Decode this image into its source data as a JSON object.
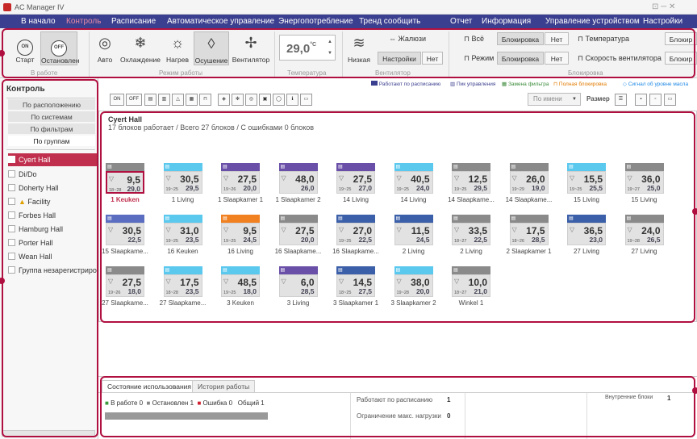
{
  "app": {
    "title": "AC Manager IV",
    "window_controls": "⊡ ─ ✕"
  },
  "menu": [
    {
      "label": "В начало"
    },
    {
      "label": "Контроль",
      "active": true
    },
    {
      "label": "Расписание"
    },
    {
      "label": "Автоматическое управление"
    },
    {
      "label": "Энергопотребление"
    },
    {
      "label": "Тренд сообщить"
    },
    {
      "label": "Отчет"
    },
    {
      "label": "Информация"
    },
    {
      "label": "Управление устройством"
    },
    {
      "label": "Настройки"
    }
  ],
  "ribbon": {
    "power": {
      "start": "Старт",
      "stop": "Остановлен",
      "on_glyph": "ON",
      "off_glyph": "OFF",
      "group": "В работе"
    },
    "modes": {
      "auto": "Авто",
      "cool": "Охлаждение",
      "heat": "Нагрев",
      "dry": "Осушение",
      "fan": "Вентилятор",
      "group": "Режим работы"
    },
    "temperature": {
      "value": "29,0",
      "unit": "°C",
      "group": "Температура"
    },
    "fan": {
      "speed": "Низкая",
      "louver": "Жалюзи",
      "settings": "Настройки",
      "no": "Нет",
      "group": "Вентилятор"
    },
    "lock": {
      "all": "Всё",
      "mode": "Режим",
      "lock_btn": "Блокировка",
      "no": "Нет",
      "temp": "Температура",
      "fan_speed": "Скорость вентилятора",
      "lock_short": "Блокир",
      "group": "Блокировка"
    }
  },
  "sidebar": {
    "title": "Контроль",
    "tabs": [
      "По расположению",
      "По системам",
      "По фильтрам",
      "По группам"
    ],
    "sites": [
      {
        "label": "Cyert Hall",
        "selected": true
      },
      {
        "label": "Di/Do"
      },
      {
        "label": "Doherty Hall"
      },
      {
        "label": "Facility",
        "warn": true
      },
      {
        "label": "Forbes Hall"
      },
      {
        "label": "Hamburg Hall"
      },
      {
        "label": "Porter Hall"
      },
      {
        "label": "Wean Hall"
      },
      {
        "label": "Группа незарегистрированных"
      }
    ]
  },
  "toolbar": {
    "on": "ON",
    "off": "OFF",
    "legend": [
      {
        "label": "Работают по расписанию",
        "color": "#3b3f8f"
      },
      {
        "label": "Пик управления",
        "color": "#3b3f8f"
      },
      {
        "label": "Замена фильтра",
        "color": "#3a8a3a"
      },
      {
        "label": "Полная блокировка",
        "color": "#e07a00"
      },
      {
        "label": "Сигнал об уровне масла",
        "color": "#1e88e5"
      }
    ],
    "sort": "По имени",
    "size": "Размер"
  },
  "main": {
    "title": "Cyert Hall",
    "summary": "17 блоков работает / Всего 27 блоков / С ошибками 0 блоков",
    "units": [
      {
        "name": "1 Keuken",
        "set": "9,5",
        "room": "29,0",
        "range": "18~28",
        "head": "#8a8a8a",
        "sel": true
      },
      {
        "name": "1 Living",
        "set": "30,5",
        "room": "29,5",
        "range": "19~25",
        "head": "#5bc8ee"
      },
      {
        "name": "1 Slaapkamer 1",
        "set": "27,5",
        "room": "20,0",
        "range": "19~26",
        "head": "#6a4fa8"
      },
      {
        "name": "1 Slaapkamer 2",
        "set": "48,0",
        "room": "26,0",
        "range": "",
        "head": "#6a4fa8"
      },
      {
        "name": "14 Living",
        "set": "27,5",
        "room": "27,0",
        "range": "19~25",
        "head": "#6a4fa8"
      },
      {
        "name": "14 Living",
        "set": "40,5",
        "room": "24,0",
        "range": "19~25",
        "head": "#5bc8ee"
      },
      {
        "name": "14 Slaapkame...",
        "set": "12,5",
        "room": "29,5",
        "range": "19~25",
        "head": "#8a8a8a"
      },
      {
        "name": "14 Slaapkame...",
        "set": "26,0",
        "room": "19,0",
        "range": "19~29",
        "head": "#8a8a8a"
      },
      {
        "name": "15 Living",
        "set": "15,5",
        "room": "25,5",
        "range": "19~25",
        "head": "#5bc8ee"
      },
      {
        "name": "15 Living",
        "set": "36,0",
        "room": "25,0",
        "range": "19~27",
        "head": "#8a8a8a"
      },
      {
        "name": "15 Slaapkame...",
        "set": "30,5",
        "room": "22,5",
        "range": "",
        "head": "#5b6dc0"
      },
      {
        "name": "16 Keuken",
        "set": "31,0",
        "room": "23,5",
        "range": "19~25",
        "head": "#5bc8ee"
      },
      {
        "name": "16 Living",
        "set": "9,5",
        "room": "24,5",
        "range": "19~25",
        "head": "#f08020"
      },
      {
        "name": "16 Slaapkame...",
        "set": "27,5",
        "room": "20,0",
        "range": "",
        "head": "#8a8a8a"
      },
      {
        "name": "16 Slaapkame...",
        "set": "27,0",
        "room": "22,5",
        "range": "19~25",
        "head": "#3b5fa8"
      },
      {
        "name": "2 Living",
        "set": "11,5",
        "room": "24,5",
        "range": "",
        "head": "#3b5fa8"
      },
      {
        "name": "2 Living",
        "set": "33,5",
        "room": "22,5",
        "range": "18~27",
        "head": "#8a8a8a"
      },
      {
        "name": "2 Slaapkamer 1",
        "set": "17,5",
        "room": "28,5",
        "range": "18~26",
        "head": "#8a8a8a"
      },
      {
        "name": "27 Living",
        "set": "36,5",
        "room": "23,0",
        "range": "",
        "head": "#3b5fa8"
      },
      {
        "name": "27 Living",
        "set": "24,0",
        "room": "26,5",
        "range": "19~28",
        "head": "#8a8a8a"
      },
      {
        "name": "27 Slaapkame...",
        "set": "27,5",
        "room": "18,0",
        "range": "19~26",
        "head": "#8a8a8a"
      },
      {
        "name": "27 Slaapkame...",
        "set": "17,5",
        "room": "23,5",
        "range": "18~28",
        "head": "#5bc8ee"
      },
      {
        "name": "3 Keuken",
        "set": "48,5",
        "room": "18,0",
        "range": "19~25",
        "head": "#5bc8ee"
      },
      {
        "name": "3 Living",
        "set": "6,0",
        "room": "28,5",
        "range": "",
        "head": "#6a4fa8"
      },
      {
        "name": "3 Slaapkamer 1",
        "set": "14,5",
        "room": "27,5",
        "range": "18~25",
        "head": "#3b5fa8"
      },
      {
        "name": "3 Slaapkamer 2",
        "set": "38,0",
        "room": "20,0",
        "range": "19~28",
        "head": "#5bc8ee"
      },
      {
        "name": "Winkel 1",
        "set": "10,0",
        "room": "21,0",
        "range": "18~27",
        "head": "#8a8a8a"
      }
    ]
  },
  "bottom": {
    "tabs": [
      "Состояние использования",
      "История работы"
    ],
    "status": {
      "working": "В работе 0",
      "stopped": "Остановлен 1",
      "error": "Ошибка 0",
      "total": "Общий 1"
    },
    "schedule": {
      "label": "Работают по расписанию",
      "value": "1"
    },
    "limit": {
      "label": "Ограничение макс. нагрузки",
      "value": "0"
    },
    "indoor": {
      "label": "Внутренние блоки",
      "value": "1"
    }
  }
}
